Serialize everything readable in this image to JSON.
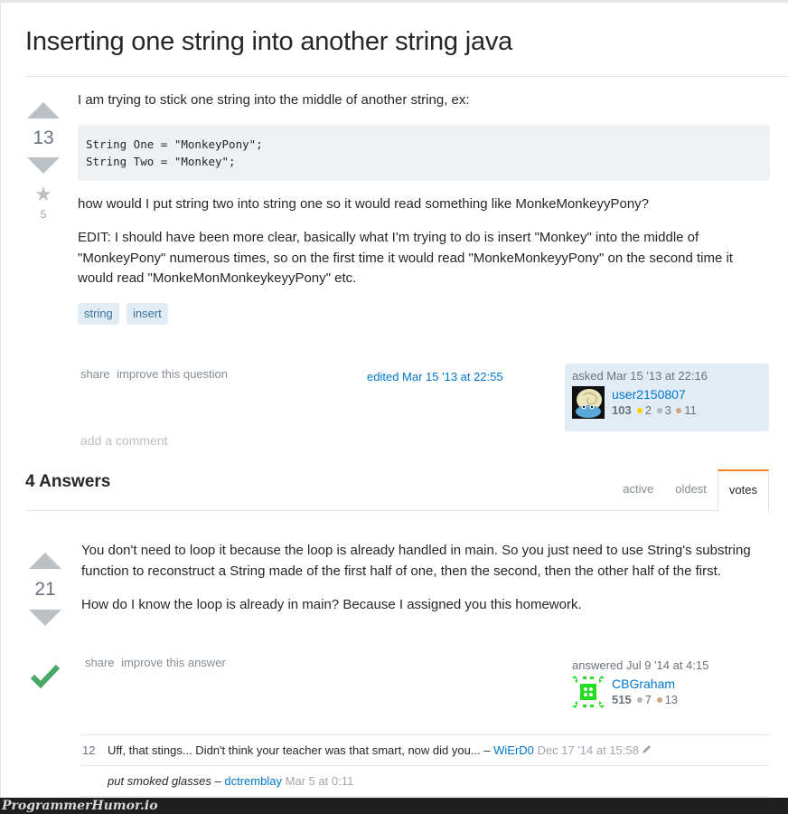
{
  "question": {
    "title": "Inserting one string into another string java",
    "votes": "13",
    "favorites": "5",
    "paragraphs": [
      "I am trying to stick one string into the middle of another string, ex:",
      "how would I put string two into string one so it would read something like MonkeMonkeyyPony?",
      "EDIT: I should have been more clear, basically what I'm trying to do is insert \"Monkey\" into the middle of \"MonkeyPony\" numerous times, so on the first time it would read \"MonkeMonkeyyPony\" on the second time it would read \"MonkeMonMonkeykeyyPony\" etc."
    ],
    "code": "String One = \"MonkeyPony\";\nString Two = \"Monkey\";",
    "tags": [
      "string",
      "insert"
    ],
    "menu": {
      "share": "share",
      "improve": "improve this question"
    },
    "edited": "edited Mar 15 '13 at 22:55",
    "asked": {
      "action": "asked Mar 15 '13 at 22:16",
      "user": "user2150807",
      "reputation": "103",
      "gold": "2",
      "silver": "3",
      "bronze": "11"
    },
    "add_comment": "add a comment"
  },
  "answers_header": "4 Answers",
  "sort_tabs": [
    {
      "label": "active",
      "selected": false
    },
    {
      "label": "oldest",
      "selected": false
    },
    {
      "label": "votes",
      "selected": true
    }
  ],
  "answer": {
    "votes": "21",
    "accepted": true,
    "paragraphs": [
      "You don't need to loop it because the loop is already handled in main. So you just need to use String's substring function to reconstruct a String made of the first half of one, then the second, then the other half of the first.",
      "How do I know the loop is already in main? Because I assigned you this homework."
    ],
    "menu": {
      "share": "share",
      "improve": "improve this answer"
    },
    "answered": {
      "action": "answered Jul 9 '14 at 4:15",
      "user": "CBGraham",
      "reputation": "515",
      "silver": "7",
      "bronze": "13"
    },
    "comments": [
      {
        "score": "12",
        "text": "Uff, that stings... Didn't think your teacher was that smart, now did you...",
        "sep": " – ",
        "user": "WiErD0",
        "date": " Dec 17 '14 at 15:58",
        "edited": true
      },
      {
        "score": "",
        "text": "put smoked glasses",
        "sep": " – ",
        "user": "dctremblay",
        "date": " Mar 5 at 0:11",
        "edited": false
      }
    ]
  },
  "footer": {
    "brand": "ProgrammerHumor.io"
  }
}
